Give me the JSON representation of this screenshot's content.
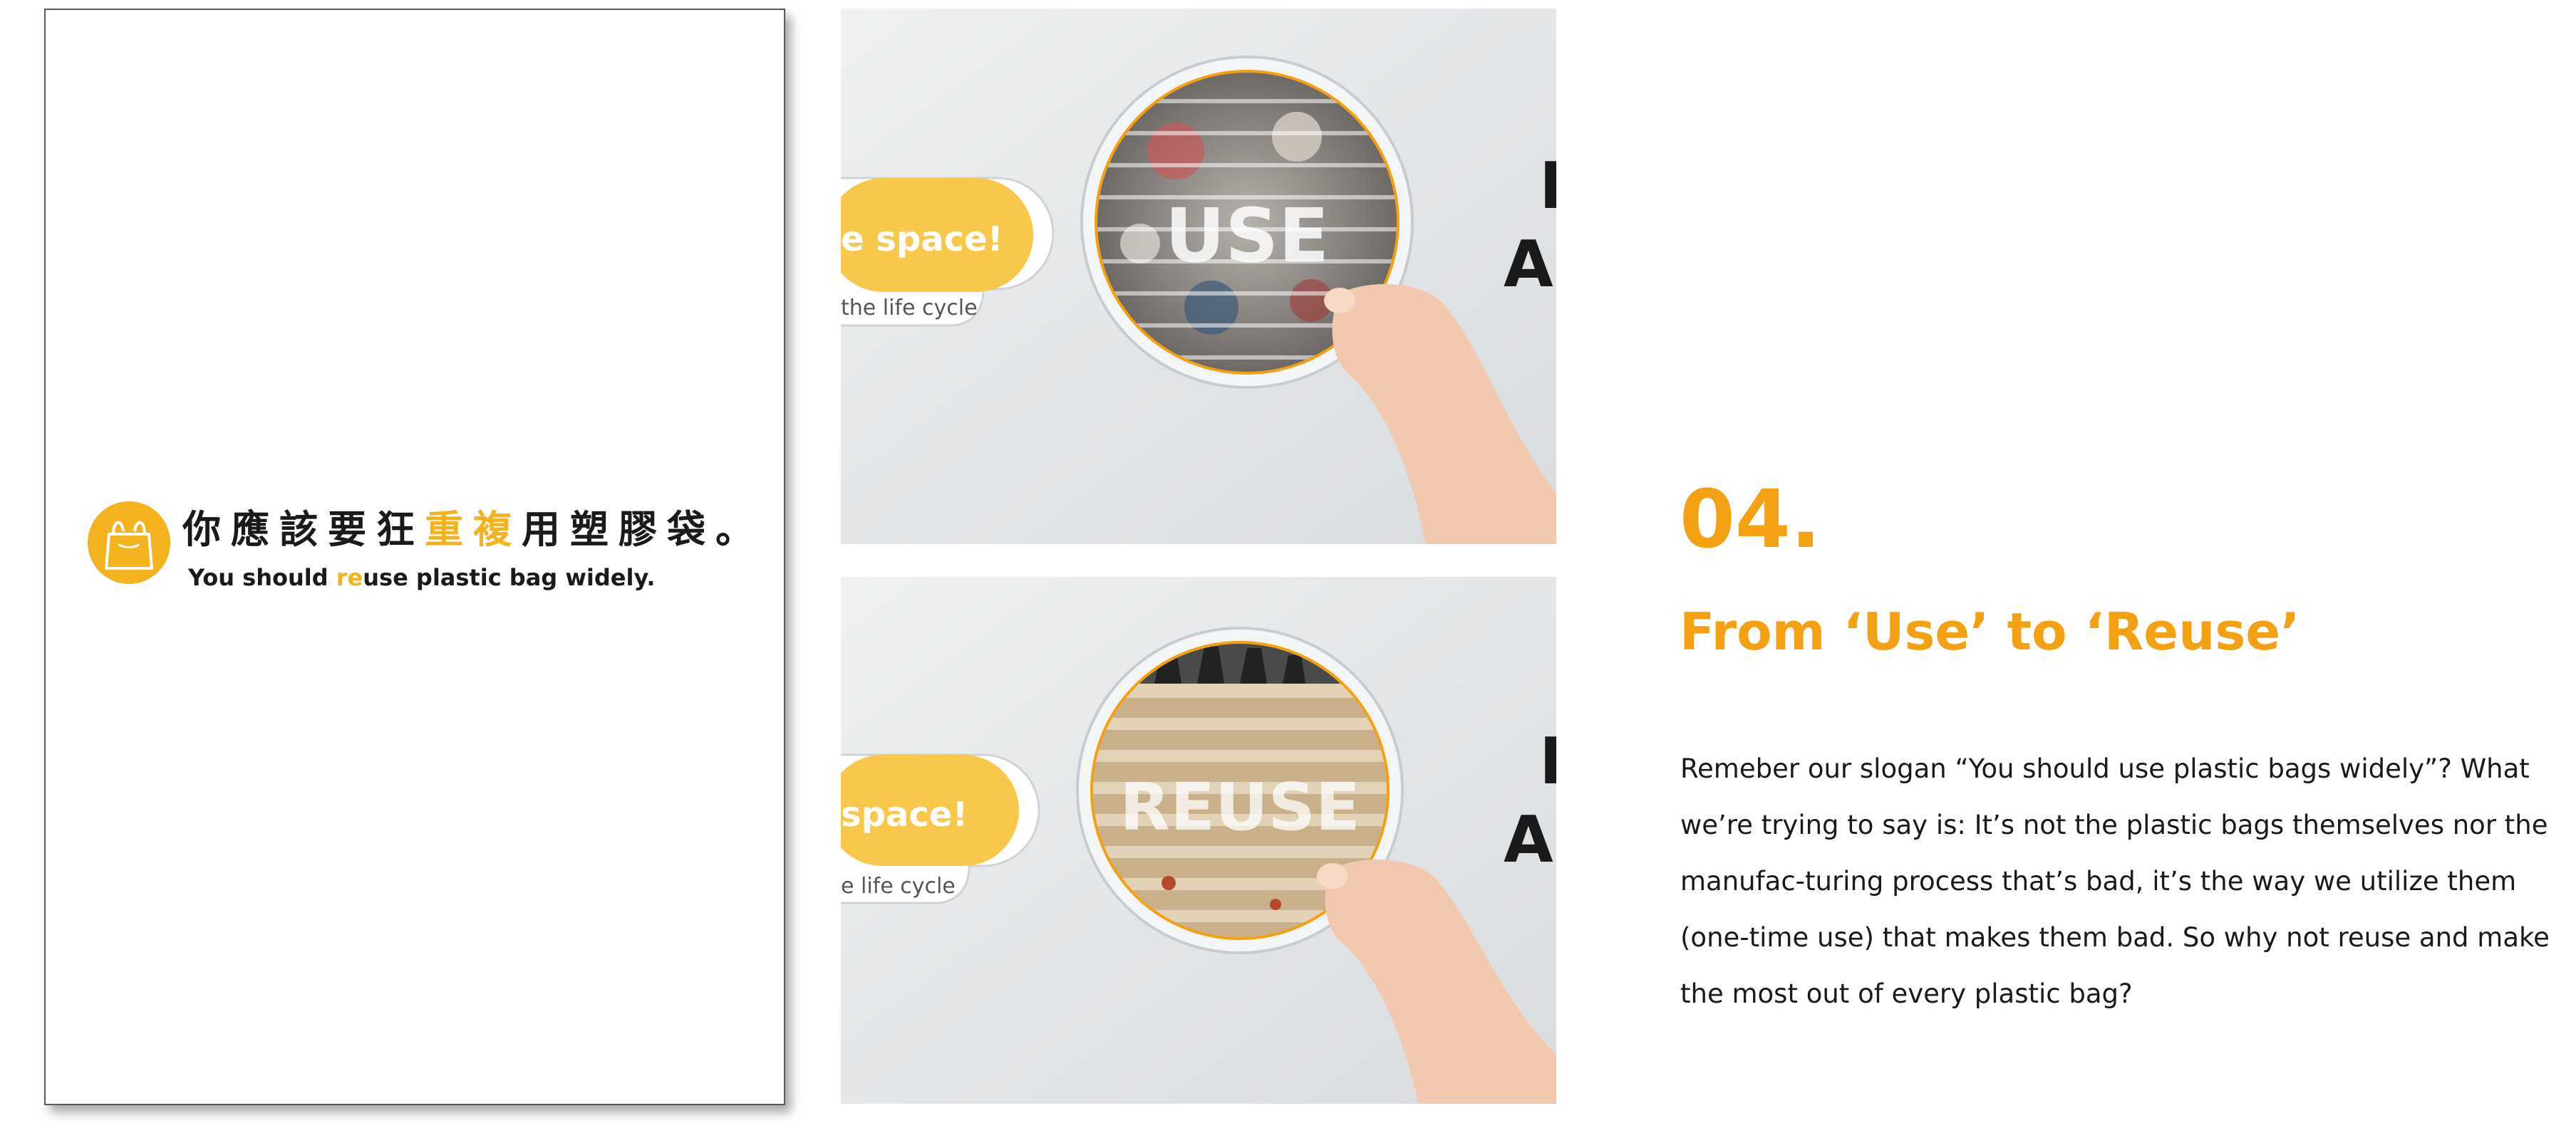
{
  "poster": {
    "zh_before": "你應該要狂",
    "zh_highlight": "重複",
    "zh_after": "用塑膠袋。",
    "en_before": "You should ",
    "en_highlight": "re",
    "en_after": "use plastic bag widely."
  },
  "photos": [
    {
      "circle_text": "USE",
      "pill_text": "e space!",
      "pill_sub": "the life cycle",
      "wall_text": "As"
    },
    {
      "circle_text": "REUSE",
      "pill_text": "space!",
      "pill_sub": "e life cycle",
      "wall_text": "As"
    }
  ],
  "section": {
    "number": "04.",
    "title": "From ‘Use’ to ‘Reuse’",
    "body": "Remeber our slogan “You should use plastic bags widely”? What we’re trying to say is: It’s not the plastic bags themselves nor the manufac-turing process that’s bad, it’s the way we utilize them (one-time use) that makes them bad. So why not reuse and make the most out of every plastic bag?"
  },
  "colors": {
    "accent": "#f3a012",
    "poster_yellow": "#f3b21e",
    "text": "#1a1a1a"
  },
  "icons": [
    "plastic-bag-icon"
  ]
}
